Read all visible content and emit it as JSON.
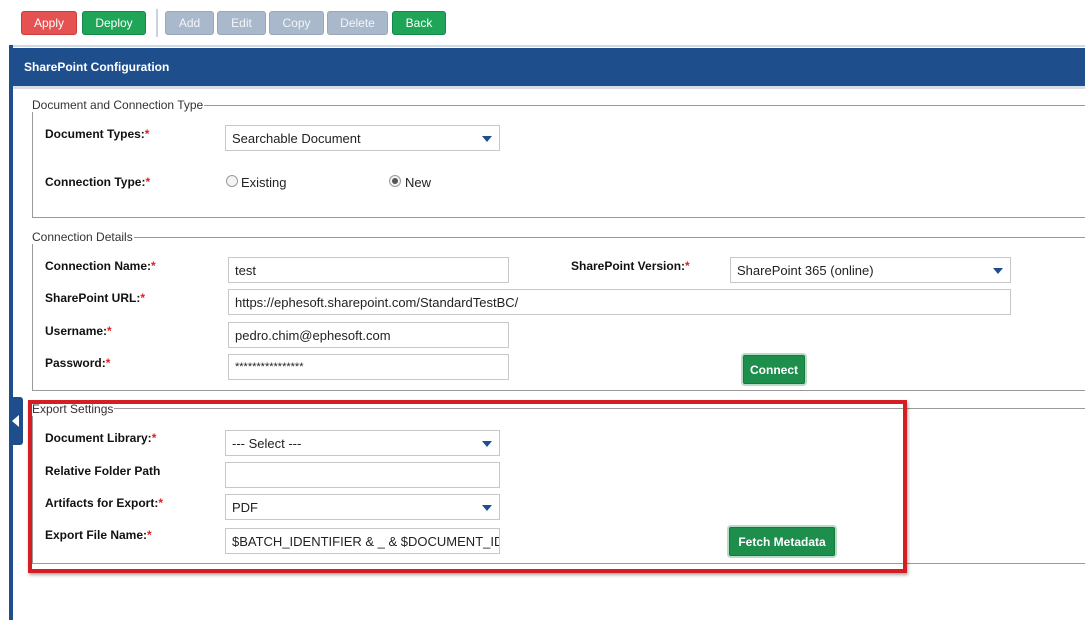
{
  "toolbar": {
    "apply": "Apply",
    "deploy": "Deploy",
    "add": "Add",
    "edit": "Edit",
    "copy": "Copy",
    "delete": "Delete",
    "back": "Back"
  },
  "header": {
    "title": "SharePoint Configuration"
  },
  "doc_conn": {
    "legend": "Document and Connection Type",
    "document_types_label": "Document Types:",
    "document_types_value": "Searchable Document",
    "connection_type_label": "Connection Type:",
    "radio_existing": "Existing",
    "radio_new": "New",
    "selected": "New"
  },
  "conn_details": {
    "legend": "Connection Details",
    "connection_name_label": "Connection Name:",
    "connection_name_value": "test",
    "sharepoint_version_label": "SharePoint Version:",
    "sharepoint_version_value": "SharePoint 365 (online)",
    "sharepoint_url_label": "SharePoint URL:",
    "sharepoint_url_value": "https://ephesoft.sharepoint.com/StandardTestBC/",
    "username_label": "Username:",
    "username_value": "pedro.chim@ephesoft.com",
    "password_label": "Password:",
    "password_value": "****************",
    "connect_button": "Connect"
  },
  "export": {
    "legend": "Export Settings",
    "document_library_label": "Document Library:",
    "document_library_value": "--- Select ---",
    "relative_folder_label": "Relative Folder Path",
    "relative_folder_value": "",
    "artifacts_label": "Artifacts for Export:",
    "artifacts_value": "PDF",
    "export_file_name_label": "Export File Name:",
    "export_file_name_value": "$BATCH_IDENTIFIER & _ & $DOCUMENT_ID",
    "fetch_metadata_button": "Fetch Metadata"
  },
  "required_marker": "*",
  "colors": {
    "primary": "#1f4e8c",
    "apply": "#e55252",
    "deploy": "#1ea558",
    "disabled": "#a9b8cb",
    "highlight": "#d41e24"
  }
}
